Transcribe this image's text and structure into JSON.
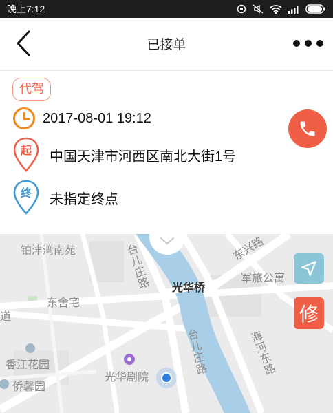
{
  "status_bar": {
    "time": "晚上7:12"
  },
  "nav": {
    "title": "已接单"
  },
  "order": {
    "type_tag": "代驾",
    "datetime": "2017-08-01 19:12",
    "start_marker": "起",
    "start_address": "中国天津市河西区南北大街1号",
    "end_marker": "终",
    "end_address": "未指定终点"
  },
  "map": {
    "labels": {
      "tiejin": "铂津湾南苑",
      "dongshe": "东舍宅",
      "xiangjiang": "香江花园",
      "qiaoxin": "侨馨园",
      "dao": "道",
      "taierzhuang_top": "台儿庄路",
      "guanghuaqiao": "光华桥",
      "dongxing": "东兴路",
      "junlv": "军旅公寓",
      "taierzhuang_bottom": "台儿庄路",
      "haihe": "海河东路",
      "guanghua_theater": "光华剧院"
    }
  },
  "actions": {
    "fix_label": "修"
  },
  "colors": {
    "accent": "#ef5f45",
    "clock_orange": "#f08a1c",
    "end_blue": "#3d9ad6",
    "river": "#a9cfe8"
  }
}
